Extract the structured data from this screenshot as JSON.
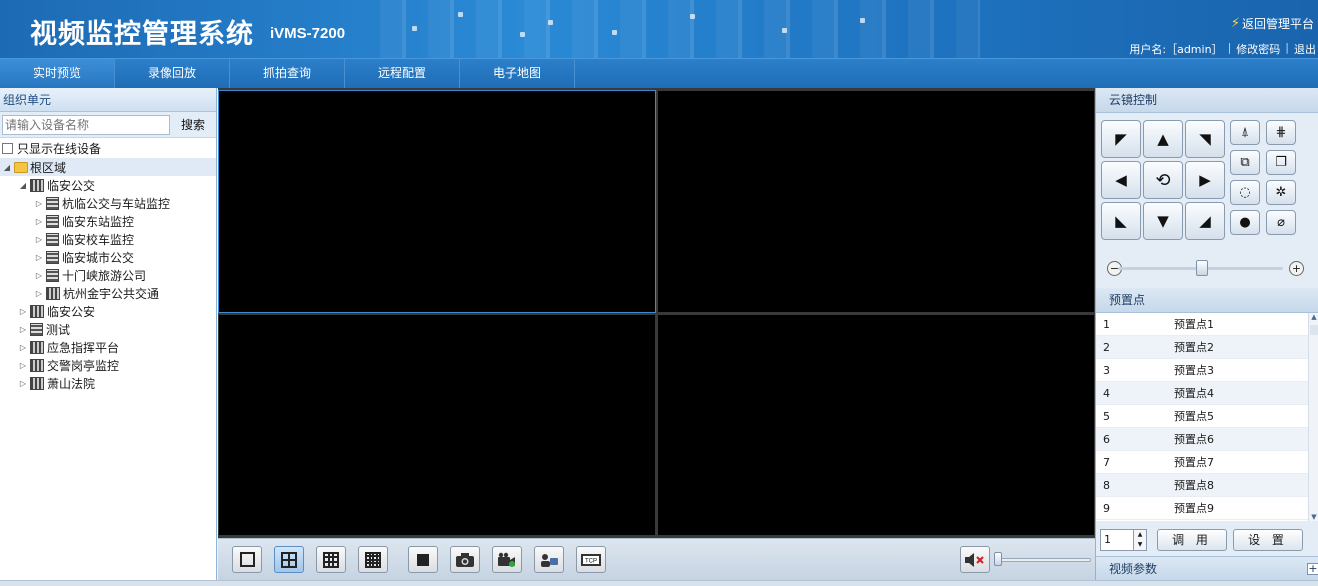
{
  "header": {
    "title": "视频监控管理系统",
    "subtitle": "iVMS-7200",
    "back_link": "返回管理平台",
    "user_label": "用户名:［admin］",
    "change_password": "修改密码",
    "logout": "退出"
  },
  "nav": {
    "tabs": [
      {
        "label": "实时预览",
        "active": true
      },
      {
        "label": "录像回放"
      },
      {
        "label": "抓拍查询"
      },
      {
        "label": "远程配置"
      },
      {
        "label": "电子地图"
      }
    ]
  },
  "left": {
    "title": "组织单元",
    "search_placeholder": "请输入设备名称",
    "search_button": "搜索",
    "online_only_label": "只显示在线设备",
    "online_only_checked": false,
    "tree": {
      "root": "根区域",
      "children": [
        {
          "label": "临安公交",
          "children": [
            "杭临公交与车站监控",
            "临安东站监控",
            "临安校车监控",
            "临安城市公交",
            "十门峡旅游公司",
            "杭州金宇公共交通"
          ]
        },
        {
          "label": "临安公安"
        },
        {
          "label": "测试"
        },
        {
          "label": "应急指挥平台"
        },
        {
          "label": "交警岗亭监控"
        },
        {
          "label": "萧山法院"
        }
      ]
    }
  },
  "toolbar": {
    "layouts": [
      "1x1",
      "2x2",
      "3x3",
      "4x4"
    ],
    "active_layout": "2x2",
    "volume_muted": true,
    "volume_level": 0
  },
  "ptz": {
    "title": "云镜控制",
    "speed_level": 0.55
  },
  "presets": {
    "title": "预置点",
    "rows": [
      {
        "num": "1",
        "name": "预置点1"
      },
      {
        "num": "2",
        "name": "预置点2"
      },
      {
        "num": "3",
        "name": "预置点3"
      },
      {
        "num": "4",
        "name": "预置点4"
      },
      {
        "num": "5",
        "name": "预置点5"
      },
      {
        "num": "6",
        "name": "预置点6"
      },
      {
        "num": "7",
        "name": "预置点7"
      },
      {
        "num": "8",
        "name": "预置点8"
      },
      {
        "num": "9",
        "name": "预置点9"
      }
    ],
    "input_value": "1",
    "call_button": "调 用",
    "set_button": "设 置"
  },
  "video_params": {
    "title": "视频参数",
    "expand": "+"
  },
  "colors": {
    "header_blue": "#1d6ab4",
    "nav_blue": "#1f6db5",
    "active_pane_border": "#3a8ad4"
  }
}
